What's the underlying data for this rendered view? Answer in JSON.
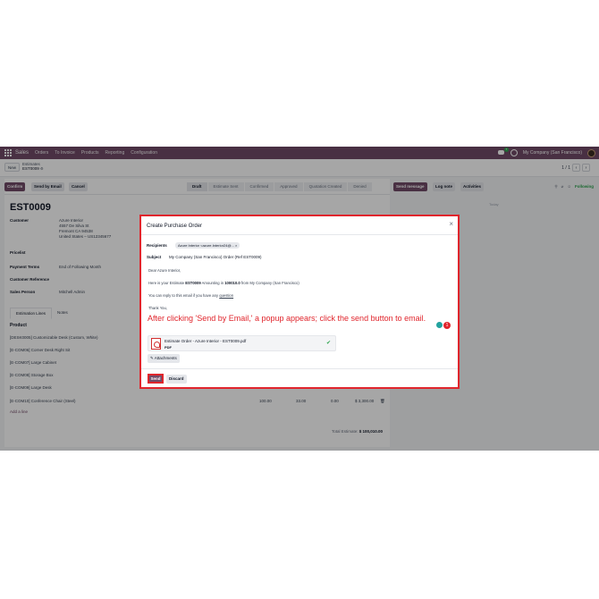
{
  "navbar": {
    "app": "Sales",
    "menus": [
      "Orders",
      "To Invoice",
      "Products",
      "Reporting",
      "Configuration"
    ],
    "chat_badge": "7",
    "company": "My Company (San Francisco)"
  },
  "control": {
    "new_label": "New",
    "parent": "Estimates",
    "record": "EST0009",
    "pager": "1 / 1"
  },
  "header_buttons": [
    "Confirm",
    "Send by Email",
    "Cancel"
  ],
  "statuses": [
    "Draft",
    "Estimate Sent",
    "Confirmed",
    "Approved",
    "Quotation Created",
    "Denied"
  ],
  "form": {
    "title": "EST0009",
    "customer_label": "Customer",
    "customer_lines": [
      "Azure Interior",
      "4557 De Silva St",
      "Fremont CA 94538",
      "United States – US12345677"
    ],
    "pricelist_label": "Pricelist",
    "payment_terms_label": "Payment Terms",
    "payment_terms": "End of Following Month",
    "customer_ref_label": "Customer Reference",
    "sales_person_label": "Sales Person",
    "sales_person": "Mitchell Admin",
    "tabs": [
      "Estimation Lines",
      "Notes"
    ],
    "table_header": "Product",
    "lines": [
      "[DESK0005] Customizable Desk (Custom, White)",
      "[E-COM06] Corner Desk Right Sit",
      "[E-COM07] Large Cabinet",
      "[E-COM08] Storage Box",
      "[E-COM09] Large Desk",
      "[E-COM10] Conference Chair (Steel)"
    ],
    "last_line_values": [
      "100.00",
      "33.00",
      "0.00",
      "$ 3,300.00"
    ],
    "add_line": "Add a line",
    "total_label": "Total Estimate:",
    "total_value": "$ 100,010.00"
  },
  "chatter": {
    "buttons": [
      "Send message",
      "Log note",
      "Activities"
    ],
    "following": "Following",
    "today": "Today"
  },
  "modal": {
    "title": "Create Purchase Order",
    "recipients_label": "Recipients",
    "recipient_tag": "Azure Interior <azure.Interior24@...",
    "subject_label": "Subject",
    "subject": "My Company (San Francisco) Order (Ref EST0009)",
    "greeting": "Dear Azure Interior,",
    "body_pre": "Here is your Estimate ",
    "body_ref": "EST0009",
    "body_mid": " Amounting in ",
    "body_amount": "100010.0",
    "body_post": " from My Company (San Francisco)",
    "reply_pre": "You can reply to this email if you have any ",
    "reply_link": "question",
    "thanks": "Thank You,",
    "instruction": "After clicking 'Send by Email,' a popup appears; click the send button to email.",
    "ai_count": "1",
    "attachment_name": "Estimate Order - Azure Interior - EST0009.pdf",
    "attachment_type": "PDF",
    "attachments_button": "Attachments",
    "send_button": "Send",
    "discard_button": "Discard"
  }
}
